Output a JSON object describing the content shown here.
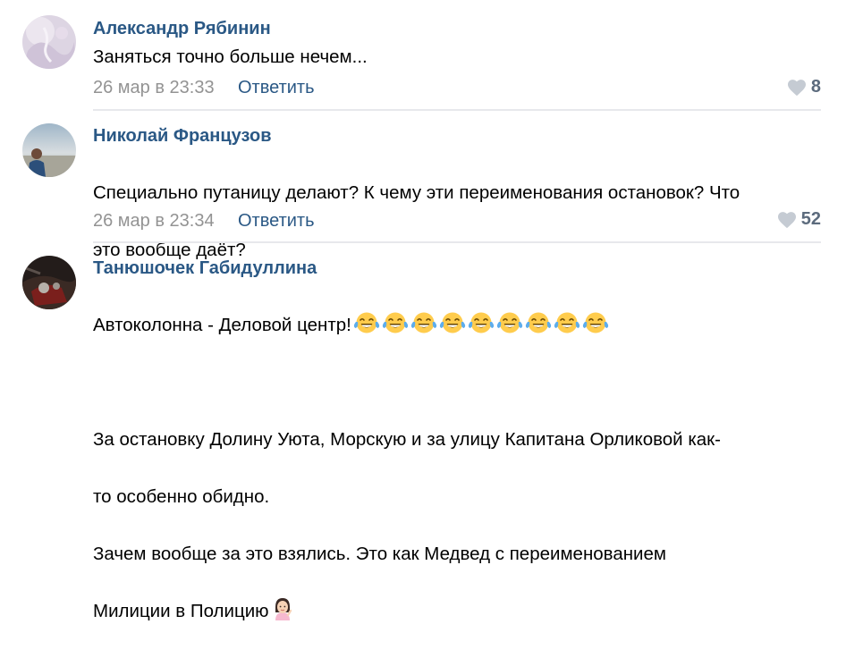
{
  "comments": [
    {
      "author": "Александр Рябинин",
      "text": "Заняться точно больше нечем...",
      "date": "26 мар в 23:33",
      "reply_label": "Ответить",
      "likes": "8"
    },
    {
      "author": "Николай Французов",
      "text_lines": [
        "Специально путаницу делают? К чему эти переименования остановок? Что",
        "это вообще даёт?"
      ],
      "date": "26 мар в 23:34",
      "reply_label": "Ответить",
      "likes": "52"
    },
    {
      "author": "Танюшочек Габидуллина",
      "text_lines": [
        "Автоколонна - Деловой центр!",
        "",
        "За остановку Долину Уюта, Морскую и за улицу Капитана Орликовой как-",
        "то особенно обидно.",
        "Зачем вообще за это взялись. Это как Медвед с переименованием",
        "Милиции в Полицию"
      ],
      "emoji_count": 9,
      "emoji_icon": "face-with-tears-of-joy-icon",
      "end_emoji_icon": "woman-tipping-hand-icon"
    }
  ],
  "colors": {
    "author": "#2a5885",
    "meta": "#939393",
    "like_heart": "#c5cbd3",
    "like_count": "#5c6b7d",
    "divider": "#e7e8ec"
  }
}
